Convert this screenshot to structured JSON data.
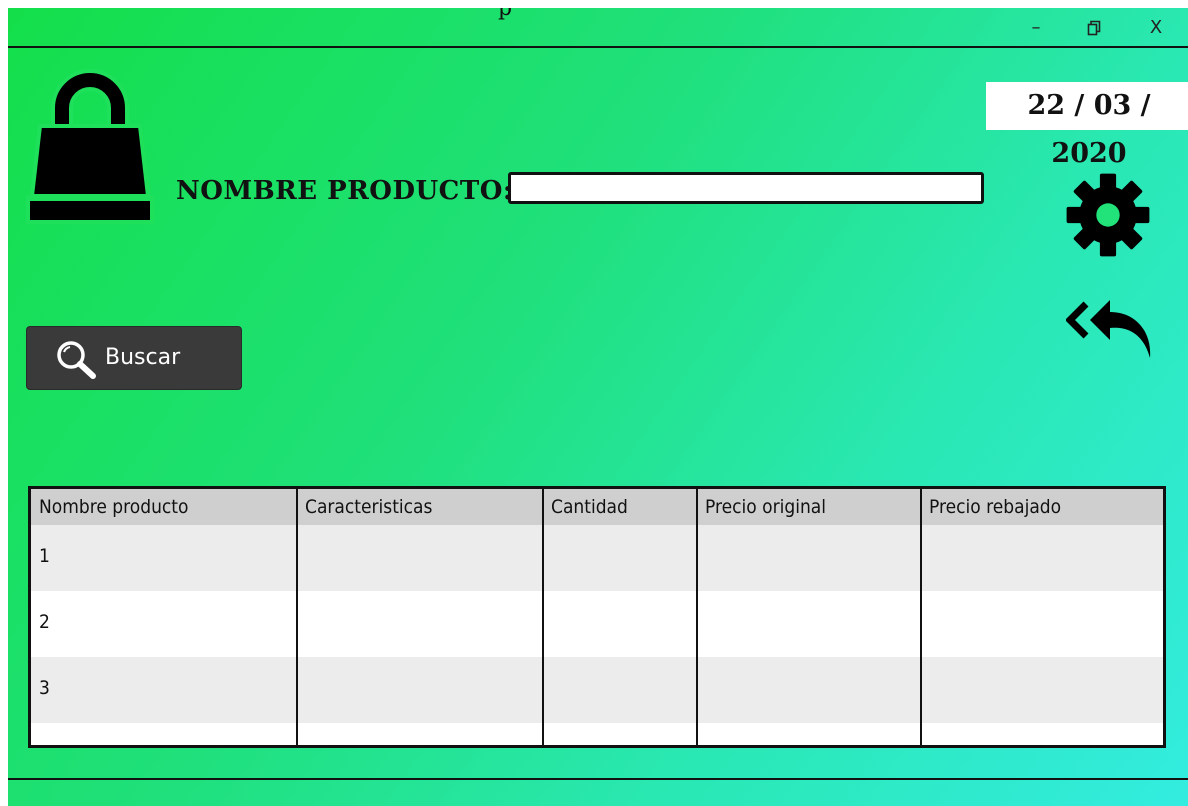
{
  "window": {
    "title_fragment": "p",
    "controls": {
      "minimize": "–",
      "maximize": "🗗",
      "close": "X"
    }
  },
  "header": {
    "date": "22 / 03 / 2020"
  },
  "form": {
    "product_label": "NOMBRE PRODUCTO:",
    "product_value": "",
    "product_placeholder": ""
  },
  "actions": {
    "search_label": "Buscar"
  },
  "icons": {
    "logo": "shopping-bag-icon",
    "settings": "gear-icon",
    "back": "back-arrow-icon",
    "search": "search-icon"
  },
  "table": {
    "columns": [
      "Nombre producto",
      "Caracteristicas",
      "Cantidad",
      "Precio original",
      "Precio rebajado"
    ],
    "rows": [
      [
        "1",
        "",
        "",
        "",
        ""
      ],
      [
        "2",
        "",
        "",
        "",
        ""
      ],
      [
        "3",
        "",
        "",
        "",
        ""
      ]
    ]
  },
  "colors": {
    "gradient_start": "#14df4a",
    "gradient_end": "#33ece0",
    "button_bg": "#3a3a3a"
  }
}
